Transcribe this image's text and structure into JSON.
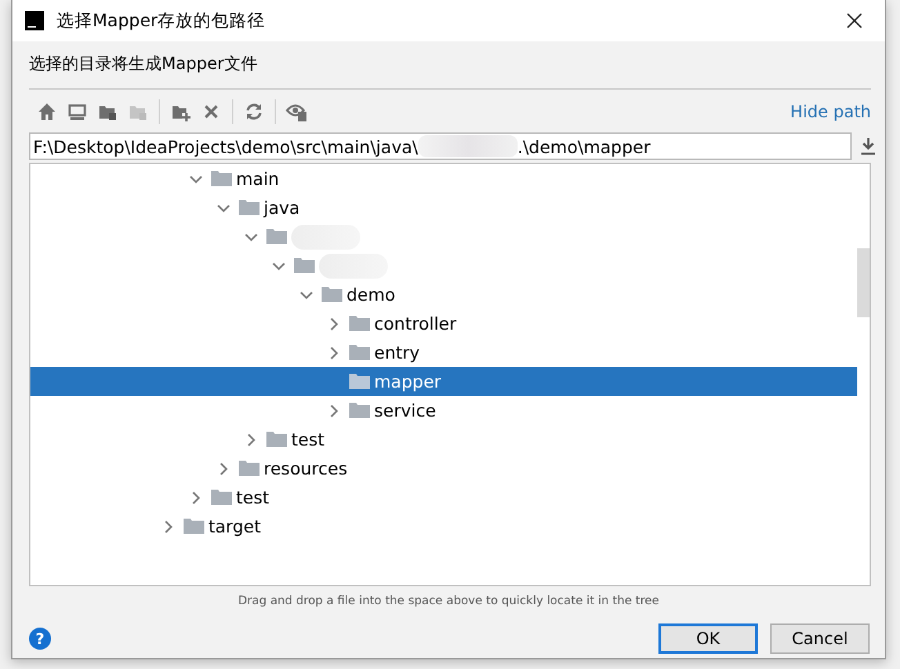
{
  "window": {
    "title": "选择Mapper存放的包路径"
  },
  "description": "选择的目录将生成Mapper文件",
  "toolbar": [
    {
      "kind": "home",
      "disabled": false
    },
    {
      "kind": "desktop",
      "disabled": false
    },
    {
      "kind": "module",
      "disabled": false
    },
    {
      "kind": "folder",
      "disabled": true
    },
    {
      "kind": "new_folder",
      "disabled": false
    },
    {
      "kind": "delete",
      "disabled": false
    },
    {
      "kind": "refresh",
      "disabled": false
    },
    {
      "kind": "show_hidden",
      "disabled": false
    }
  ],
  "hide_path_link": "Hide path",
  "path_field": {
    "value_parts": [
      "F:\\Desktop\\IdeaProjects\\demo\\src\\main\\java\\",
      ".\\demo\\mapper"
    ]
  },
  "tree": {
    "items": [
      {
        "kind": "group",
        "children": [
          {
            "kind": "folder",
            "label": "main",
            "expanded": true,
            "selected": false,
            "children": [
              {
                "kind": "folder",
                "label": "java",
                "expanded": true,
                "selected": false,
                "children": [
                  {
                    "kind": "blurred",
                    "expanded": true,
                    "selected": false,
                    "children": [
                      {
                        "kind": "blurred",
                        "expanded": true,
                        "selected": false,
                        "children": [
                          {
                            "kind": "folder",
                            "label": "demo",
                            "expanded": true,
                            "selected": false,
                            "children": [
                              {
                                "kind": "folder",
                                "label": "controller",
                                "expanded": false,
                                "selected": false
                              },
                              {
                                "kind": "folder",
                                "label": "entry",
                                "expanded": false,
                                "selected": false
                              },
                              {
                                "kind": "leaf",
                                "label": "mapper",
                                "selected": true
                              },
                              {
                                "kind": "folder",
                                "label": "service",
                                "expanded": false,
                                "selected": false
                              }
                            ]
                          }
                        ]
                      }
                    ]
                  },
                  {
                    "kind": "folder",
                    "label": "test",
                    "expanded": false,
                    "selected": false
                  }
                ]
              },
              {
                "kind": "folder",
                "label": "resources",
                "expanded": false,
                "selected": false
              }
            ]
          },
          {
            "kind": "folder",
            "label": "test",
            "expanded": false,
            "selected": false
          }
        ]
      },
      {
        "kind": "folder",
        "label": "target",
        "expanded": false,
        "selected": false
      }
    ]
  },
  "hint": "Drag and drop a file into the space above to quickly locate it in the tree",
  "help_button": {
    "label": "?"
  },
  "buttons": [
    {
      "label": "OK",
      "default": true
    },
    {
      "label": "Cancel",
      "default": false
    }
  ]
}
